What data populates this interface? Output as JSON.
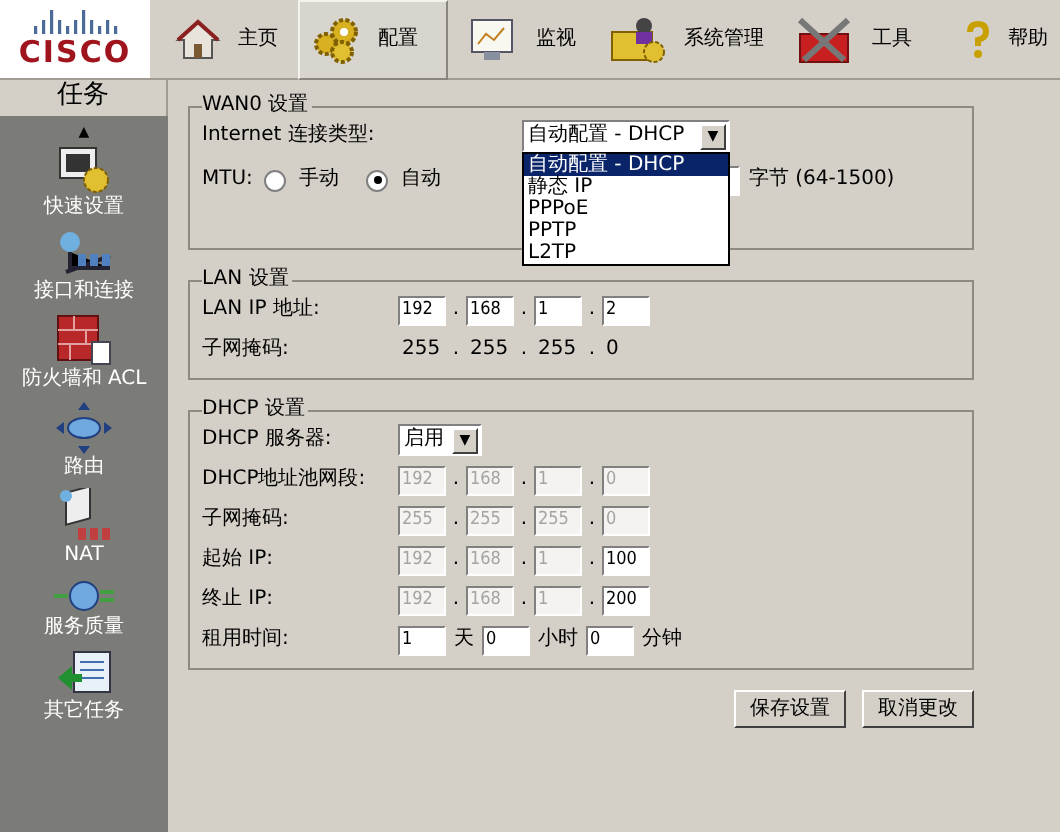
{
  "logo": "CISCO",
  "nav_tabs": [
    {
      "label": "主页",
      "selected": false
    },
    {
      "label": "配置",
      "selected": true
    },
    {
      "label": "监视",
      "selected": false
    },
    {
      "label": "系统管理",
      "selected": false
    },
    {
      "label": "工具",
      "selected": false
    },
    {
      "label": "帮助",
      "selected": false
    }
  ],
  "sidebar": {
    "title": "任务",
    "scroll_up": "▲",
    "items": [
      {
        "label": "快速设置"
      },
      {
        "label": "接口和连接"
      },
      {
        "label": "防火墙和 ACL"
      },
      {
        "label": "路由"
      },
      {
        "label": "NAT"
      },
      {
        "label": "服务质量"
      },
      {
        "label": "其它任务"
      }
    ]
  },
  "wan": {
    "title": "WAN0 设置",
    "connection_label": "Internet 连接类型:",
    "connection_value": "自动配置 - DHCP",
    "connection_caret": "▼",
    "connection_options": [
      {
        "label": "自动配置 - DHCP",
        "selected": true
      },
      {
        "label": "静态 IP",
        "selected": false
      },
      {
        "label": "PPPoE",
        "selected": false
      },
      {
        "label": "PPTP",
        "selected": false
      },
      {
        "label": "L2TP",
        "selected": false
      }
    ],
    "mtu_label": "MTU:",
    "mtu_modes": [
      {
        "label": "手动",
        "selected": false
      },
      {
        "label": "自动",
        "selected": true
      }
    ],
    "mtu_unit": "字节 (64-1500)"
  },
  "lan": {
    "title": "LAN 设置",
    "ip_label": "LAN IP 地址:",
    "ip": [
      {
        "value": "192",
        "disabled": false
      },
      {
        "value": "168",
        "disabled": false
      },
      {
        "value": "1",
        "disabled": false
      },
      {
        "value": "2",
        "disabled": false
      }
    ],
    "separator": ".",
    "mask_label": "子网掩码:",
    "mask": [
      "255",
      "255",
      "255",
      "0"
    ]
  },
  "dhcp": {
    "title": "DHCP 设置",
    "server_label": "DHCP 服务器:",
    "server_value": "启用",
    "server_caret": "▼",
    "separator": ".",
    "rows": [
      {
        "label": "DHCP地址池网段:",
        "octets": [
          {
            "value": "192",
            "disabled": true
          },
          {
            "value": "168",
            "disabled": true
          },
          {
            "value": "1",
            "disabled": true
          },
          {
            "value": "0",
            "disabled": true
          }
        ]
      },
      {
        "label": "子网掩码:",
        "octets": [
          {
            "value": "255",
            "disabled": true
          },
          {
            "value": "255",
            "disabled": true
          },
          {
            "value": "255",
            "disabled": true
          },
          {
            "value": "0",
            "disabled": true
          }
        ]
      },
      {
        "label": "起始 IP:",
        "octets": [
          {
            "value": "192",
            "disabled": true
          },
          {
            "value": "168",
            "disabled": true
          },
          {
            "value": "1",
            "disabled": true
          },
          {
            "value": "100",
            "disabled": false
          }
        ]
      },
      {
        "label": "终止 IP:",
        "octets": [
          {
            "value": "192",
            "disabled": true
          },
          {
            "value": "168",
            "disabled": true
          },
          {
            "value": "1",
            "disabled": true
          },
          {
            "value": "200",
            "disabled": false
          }
        ]
      }
    ],
    "lease_label": "租用时间:",
    "lease": [
      {
        "value": "1",
        "unit": "天"
      },
      {
        "value": "0",
        "unit": "小时"
      },
      {
        "value": "0",
        "unit": "分钟"
      }
    ]
  },
  "buttons": [
    "保存设置",
    "取消更改"
  ]
}
